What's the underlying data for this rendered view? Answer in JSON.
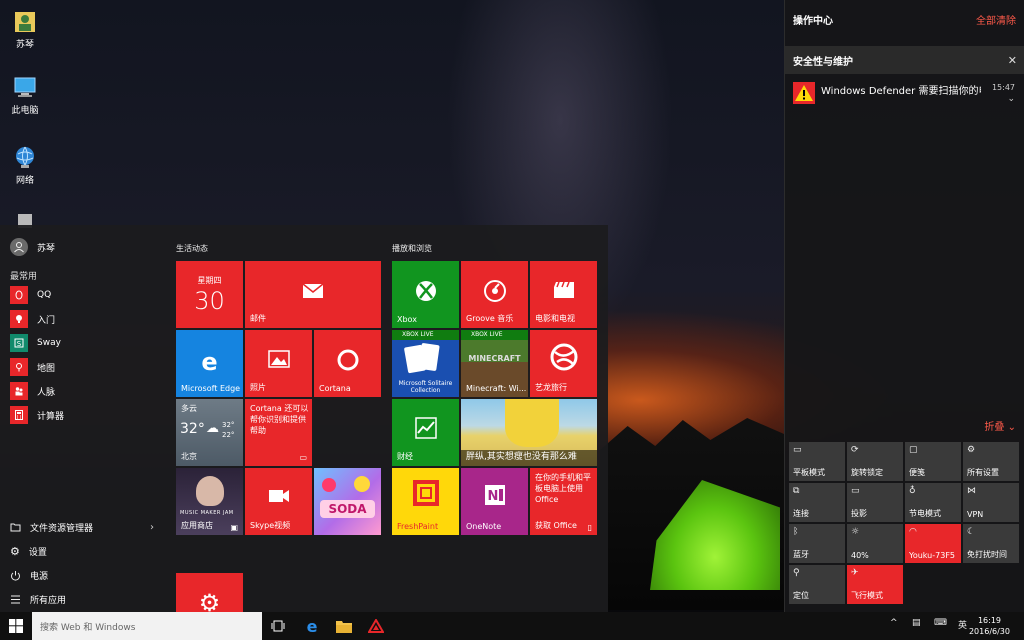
{
  "desktop": {
    "icons": [
      {
        "label": "苏琴",
        "icon": "user-folder-icon"
      },
      {
        "label": "此电脑",
        "icon": "computer-icon"
      },
      {
        "label": "网络",
        "icon": "network-globe-icon"
      },
      {
        "label": "",
        "icon": "recycle-bin-icon"
      }
    ]
  },
  "start_menu": {
    "user_name": "苏琴",
    "most_used_label": "最常用",
    "apps": [
      {
        "label": "QQ",
        "color": "#e8272a"
      },
      {
        "label": "入门",
        "color": "#e8272a"
      },
      {
        "label": "Sway",
        "color": "#118a6c"
      },
      {
        "label": "地图",
        "color": "#e8272a"
      },
      {
        "label": "人脉",
        "color": "#e8272a"
      },
      {
        "label": "计算器",
        "color": "#e8272a"
      }
    ],
    "bottom": {
      "file_explorer": "文件资源管理器",
      "settings": "设置",
      "power": "电源",
      "all_apps": "所有应用"
    },
    "group_life": "生活动态",
    "group_play": "播放和浏览",
    "tiles": {
      "calendar_weekday": "星期四",
      "calendar_day": "30",
      "mail": "邮件",
      "edge": "Microsoft Edge",
      "photos": "照片",
      "cortana": "Cortana",
      "weather_cond": "多云",
      "weather_temp": "32°",
      "weather_high": "32°",
      "weather_low": "22°",
      "weather_city": "北京",
      "cortana_msg": "Cortana 还可以帮你识别和提供帮助",
      "store": "应用商店",
      "store_promo": "MUSIC MAKER JAM",
      "skype": "Skype视频",
      "candy_badge": "SODA",
      "xbox": "Xbox",
      "groove": "Groove 音乐",
      "movies": "电影和电视",
      "xbox_live_1": "XBOX LIVE",
      "xbox_live_2": "XBOX LIVE",
      "solitaire": "Microsoft Solitaire Collection",
      "minecraft": "Minecraft: Wi...",
      "minecraft_logo": "MINECRAFT",
      "yilong": "艺龙旅行",
      "finance": "财经",
      "news": "胖纵,其实想瘦也没有那么难",
      "freshpaint": "FreshPaint",
      "onenote": "OneNote",
      "office_msg": "在你的手机和平板电脑上使用 Office",
      "office_get": "获取 Office"
    }
  },
  "taskbar": {
    "search_placeholder": "搜索 Web 和 Windows",
    "ime": "英",
    "time": "16:19",
    "date": "2016/6/30"
  },
  "action_center": {
    "title": "操作中心",
    "clear_all": "全部清除",
    "notif_group": "安全性与维护",
    "notif_text": "Windows Defender 需要扫描你的电脑",
    "notif_time": "15:47",
    "collapse": "折叠",
    "quick_actions": [
      {
        "label": "平板模式",
        "icon": "tablet-mode-icon",
        "glyph": "▭",
        "on": false
      },
      {
        "label": "旋转锁定",
        "icon": "rotation-lock-icon",
        "glyph": "⟳",
        "on": false
      },
      {
        "label": "便笺",
        "icon": "note-icon",
        "glyph": "▢",
        "on": false
      },
      {
        "label": "所有设置",
        "icon": "gear-icon",
        "glyph": "⚙",
        "on": false
      },
      {
        "label": "连接",
        "icon": "connect-icon",
        "glyph": "⧉",
        "on": false
      },
      {
        "label": "投影",
        "icon": "project-icon",
        "glyph": "▭",
        "on": false
      },
      {
        "label": "节电模式",
        "icon": "battery-saver-icon",
        "glyph": "♁",
        "on": false
      },
      {
        "label": "VPN",
        "icon": "vpn-icon",
        "glyph": "⋈",
        "on": false
      },
      {
        "label": "蓝牙",
        "icon": "bluetooth-icon",
        "glyph": "ᛒ",
        "on": false
      },
      {
        "label": "40%",
        "icon": "brightness-icon",
        "glyph": "☼",
        "on": false
      },
      {
        "label": "Youku-73F5",
        "icon": "wifi-icon",
        "glyph": "◠",
        "on": true
      },
      {
        "label": "免打扰时间",
        "icon": "quiet-hours-icon",
        "glyph": "☾",
        "on": false
      },
      {
        "label": "定位",
        "icon": "location-icon",
        "glyph": "⚲",
        "on": false
      },
      {
        "label": "飞行模式",
        "icon": "airplane-icon",
        "glyph": "✈",
        "on": true
      }
    ]
  }
}
